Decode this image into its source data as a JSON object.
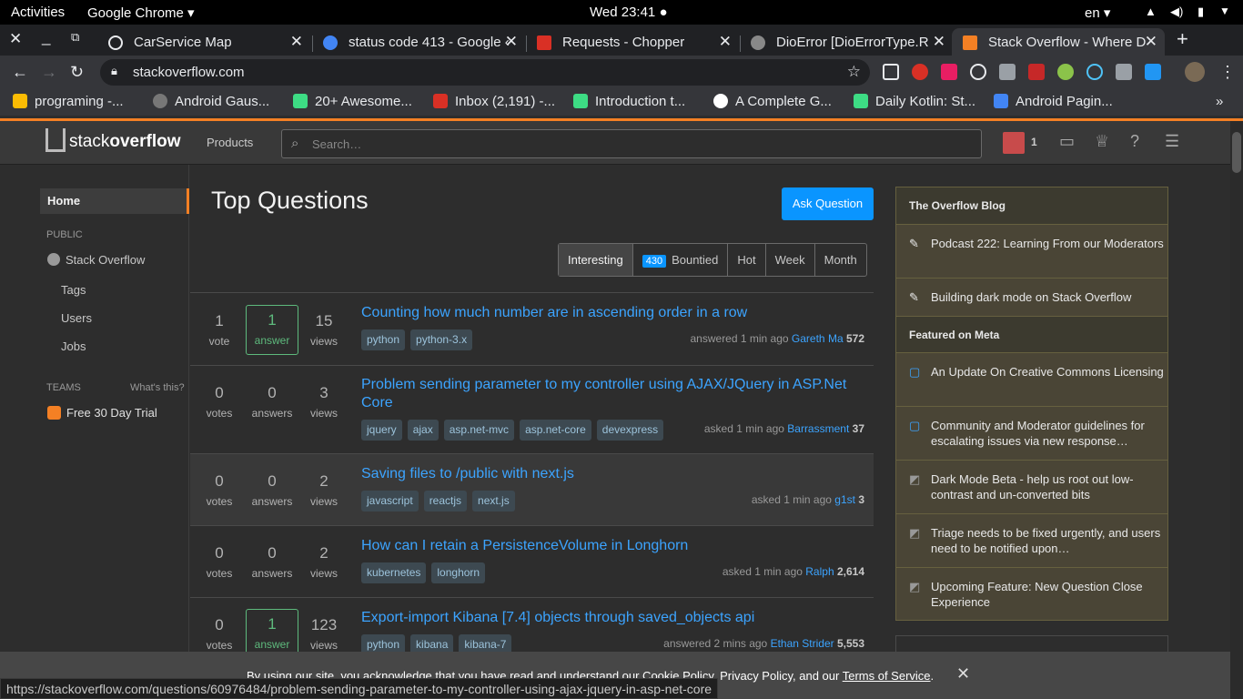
{
  "os": {
    "activities": "Activities",
    "app": "Google Chrome ▾",
    "clock": "Wed 23:41 ●",
    "lang": "en ▾"
  },
  "tabs": [
    {
      "title": "CarService Map",
      "color": "#8ab4f8"
    },
    {
      "title": "status code 413 - Google ‹",
      "color": "#4285f4"
    },
    {
      "title": "Requests - Chopper",
      "color": "#d93025"
    },
    {
      "title": "DioError [DioErrorType.R",
      "color": "#888"
    },
    {
      "title": "Stack Overflow - Where D",
      "color": "#f48024"
    }
  ],
  "omnibox": {
    "url": "stackoverflow.com"
  },
  "bookmarks": [
    {
      "label": "programing -...",
      "color": "#fbbc04"
    },
    {
      "label": "Android Gaus...",
      "color": "#777"
    },
    {
      "label": "20+ Awesome...",
      "color": "#3ddc84"
    },
    {
      "label": "Inbox (2,191) -...",
      "color": "#d93025"
    },
    {
      "label": "Introduction t...",
      "color": "#3ddc84"
    },
    {
      "label": "A Complete G...",
      "color": "#fff"
    },
    {
      "label": "Daily Kotlin: St...",
      "color": "#3ddc84"
    },
    {
      "label": "Android Pagin...",
      "color": "#4285f4"
    }
  ],
  "so": {
    "logo_a": "stack",
    "logo_b": "overflow",
    "products": "Products",
    "search_placeholder": "Search…",
    "inbox_count": "1"
  },
  "sidebar": {
    "home": "Home",
    "public": "PUBLIC",
    "stack_overflow": "Stack Overflow",
    "tags": "Tags",
    "users": "Users",
    "jobs": "Jobs",
    "teams": "TEAMS",
    "whats_this": "What's this?",
    "trial": "Free 30 Day Trial"
  },
  "main": {
    "title": "Top Questions",
    "ask": "Ask Question",
    "filters": [
      "Interesting",
      "Bountied",
      "Hot",
      "Week",
      "Month"
    ],
    "bounty_count": "430"
  },
  "questions": [
    {
      "votes": "1",
      "votes_l": "vote",
      "answers": "1",
      "answers_l": "answer",
      "views": "15",
      "views_l": "views",
      "accepted": true,
      "title": "Counting how much number are in ascending order in a row",
      "tags": [
        "python",
        "python-3.x"
      ],
      "action": "answered 1 min ago",
      "user": "Gareth Ma",
      "rep": "572"
    },
    {
      "votes": "0",
      "votes_l": "votes",
      "answers": "0",
      "answers_l": "answers",
      "views": "3",
      "views_l": "views",
      "title": "Problem sending parameter to my controller using AJAX/JQuery in ASP.Net Core",
      "tags": [
        "jquery",
        "ajax",
        "asp.net-mvc",
        "asp.net-core",
        "devexpress"
      ],
      "action": "asked 1 min ago",
      "user": "Barrassment",
      "rep": "37"
    },
    {
      "votes": "0",
      "votes_l": "votes",
      "answers": "0",
      "answers_l": "answers",
      "views": "2",
      "views_l": "views",
      "title": "Saving files to /public with next.js",
      "tags": [
        "javascript",
        "reactjs",
        "next.js"
      ],
      "action": "asked 1 min ago",
      "user": "g1st",
      "rep": "3"
    },
    {
      "votes": "0",
      "votes_l": "votes",
      "answers": "0",
      "answers_l": "answers",
      "views": "2",
      "views_l": "views",
      "title": "How can I retain a PersistenceVolume in Longhorn",
      "tags": [
        "kubernetes",
        "longhorn"
      ],
      "action": "asked 1 min ago",
      "user": "Ralph",
      "rep": "2,614"
    },
    {
      "votes": "0",
      "votes_l": "votes",
      "answers": "1",
      "answers_l": "answer",
      "views": "123",
      "views_l": "views",
      "accepted": true,
      "title": "Export-import Kibana [7.4] objects through saved_objects api",
      "tags": [
        "python",
        "kibana",
        "kibana-7"
      ],
      "action": "answered 2 mins ago",
      "user": "Ethan Strider",
      "rep": "5,553"
    }
  ],
  "blog": {
    "header1": "The Overflow Blog",
    "items1": [
      "Podcast 222: Learning From our Moderators",
      "Building dark mode on Stack Overflow"
    ],
    "header2": "Featured on Meta",
    "items2": [
      "An Update On Creative Commons Licensing",
      "Community and Moderator guidelines for escalating issues via new response…",
      "Dark Mode Beta - help us root out low-contrast and un-converted bits",
      "Triage needs to be fixed urgently, and users need to be notified upon…",
      "Upcoming Feature: New Question Close Experience"
    ]
  },
  "cookie": {
    "text": "By using our site, you acknowledge that you have read and understand our Cookie Policy, Privacy Policy, and our ",
    "terms": "Terms of Service",
    "suffix": "."
  },
  "status_url": "https://stackoverflow.com/questions/60976484/problem-sending-parameter-to-my-controller-using-ajax-jquery-in-asp-net-core"
}
